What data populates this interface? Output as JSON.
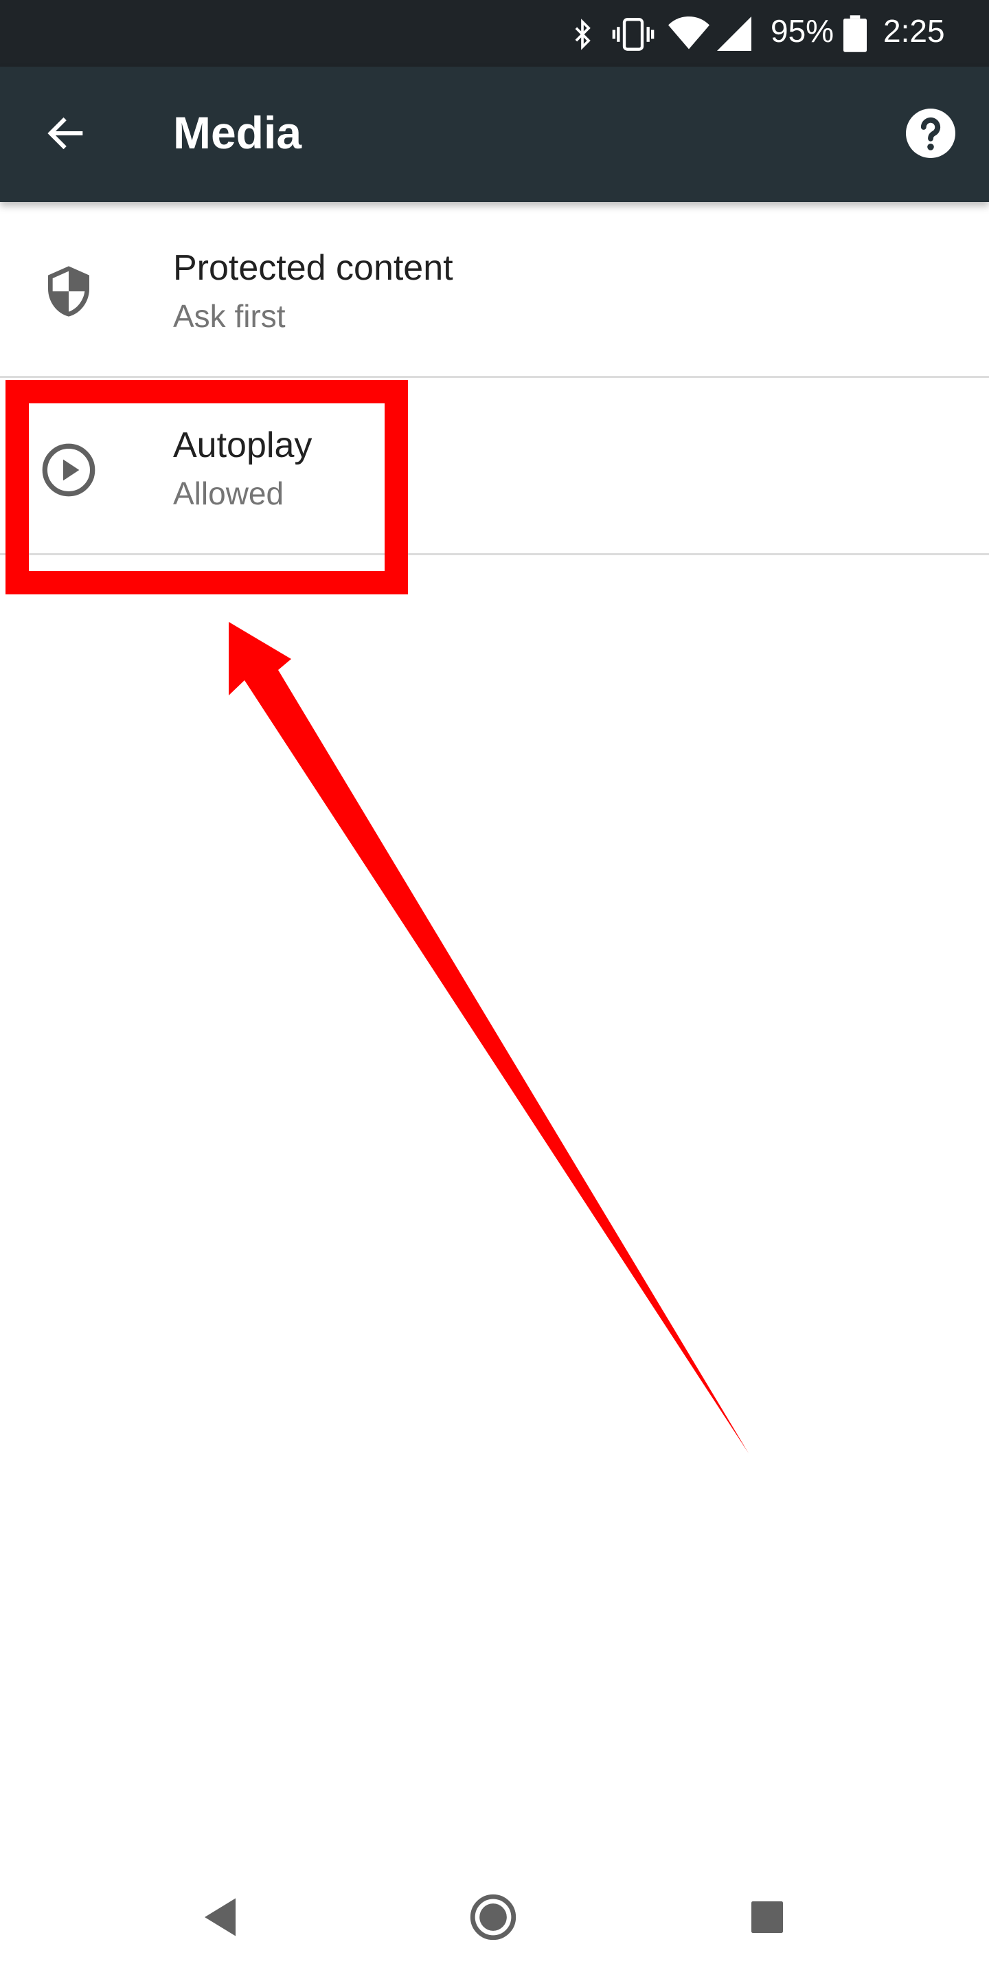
{
  "status_bar": {
    "battery": "95%",
    "time": "2:25",
    "icons": [
      "bluetooth-icon",
      "vibrate-icon",
      "wifi-icon",
      "cell-signal-icon",
      "battery-icon"
    ]
  },
  "app_bar": {
    "title": "Media",
    "icons": [
      "back-arrow-icon",
      "help-icon"
    ]
  },
  "items": [
    {
      "title": "Protected content",
      "subtitle": "Ask first",
      "icon": "shield-icon"
    },
    {
      "title": "Autoplay",
      "subtitle": "Allowed",
      "icon": "play-circle-icon"
    }
  ],
  "nav_bar": {
    "icons": [
      "nav-back-icon",
      "nav-home-icon",
      "nav-recents-icon"
    ]
  },
  "colors": {
    "status_bar": "#1f2428",
    "app_bar": "#263238",
    "annotation": "#ff0000",
    "title_text": "#212121",
    "subtitle_text": "#757575"
  }
}
